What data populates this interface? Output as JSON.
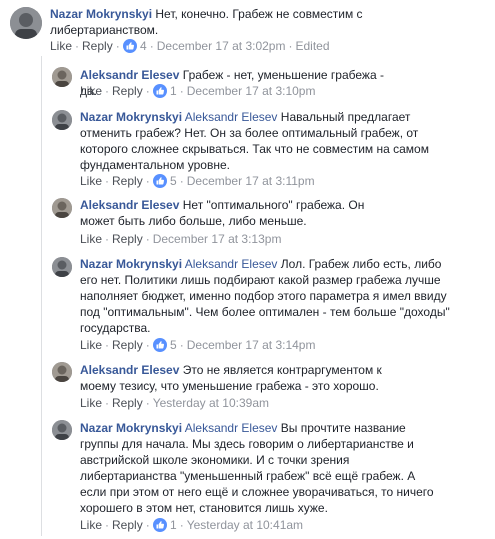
{
  "sep": "·",
  "like_icon": "like-reaction-icon",
  "accent": "#385898",
  "comments": [
    {
      "author": "Nazar Mokrynskyi",
      "text": "Нет, конечно. Грабеж не совместим с либертарианством.",
      "like": "Like",
      "reply": "Reply",
      "reactions": "4",
      "time": "December 17 at 3:02pm",
      "edited": "Edited"
    },
    {
      "author": "Aleksandr Elesev",
      "text": "Грабеж - нет, уменьшение грабежа - да.",
      "like": "Like",
      "reply": "Reply",
      "reactions": "1",
      "time": "December 17 at 3:10pm"
    },
    {
      "author": "Nazar Mokrynskyi",
      "mention": "Aleksandr Elesev",
      "text": "Навальный предлагает отменить грабеж? Нет. Он за более оптимальный грабеж, от которого сложнее скрываться. Так что не совместим на самом фундаментальном уровне.",
      "like": "Like",
      "reply": "Reply",
      "reactions": "5",
      "time": "December 17 at 3:11pm"
    },
    {
      "author": "Aleksandr Elesev",
      "text": "Нет \"оптимального\" грабежа. Он может быть либо больше, либо меньше.",
      "like": "Like",
      "reply": "Reply",
      "time": "December 17 at 3:13pm"
    },
    {
      "author": "Nazar Mokrynskyi",
      "mention": "Aleksandr Elesev",
      "text": "Лол. Грабеж либо есть, либо его нет. Политики лишь подбирают какой размер грабежа лучше наполняет бюджет, именно подбор этого параметра я имел ввиду под \"оптимальным\". Чем более оптимален - тем больше \"доходы\" государства.",
      "like": "Like",
      "reply": "Reply",
      "reactions": "5",
      "time": "December 17 at 3:14pm"
    },
    {
      "author": "Aleksandr Elesev",
      "text": "Это не является контраргументом к моему тезису, что уменьшение грабежа - это хорошо.",
      "like": "Like",
      "reply": "Reply",
      "time": "Yesterday at 10:39am"
    },
    {
      "author": "Nazar Mokrynskyi",
      "mention": "Aleksandr Elesev",
      "text": "Вы прочтите название группы для начала. Мы здесь говорим о либертарианстве и австрийской школе экономики. И с точки зрения либертарианства \"уменьшенный грабеж\" всё ещё грабеж. А если при этом от него ещё и сложнее уворачиваться, то ничего хорошего в этом нет, становится лишь хуже.",
      "like": "Like",
      "reply": "Reply",
      "reactions": "1",
      "time": "Yesterday at 10:41am"
    }
  ]
}
